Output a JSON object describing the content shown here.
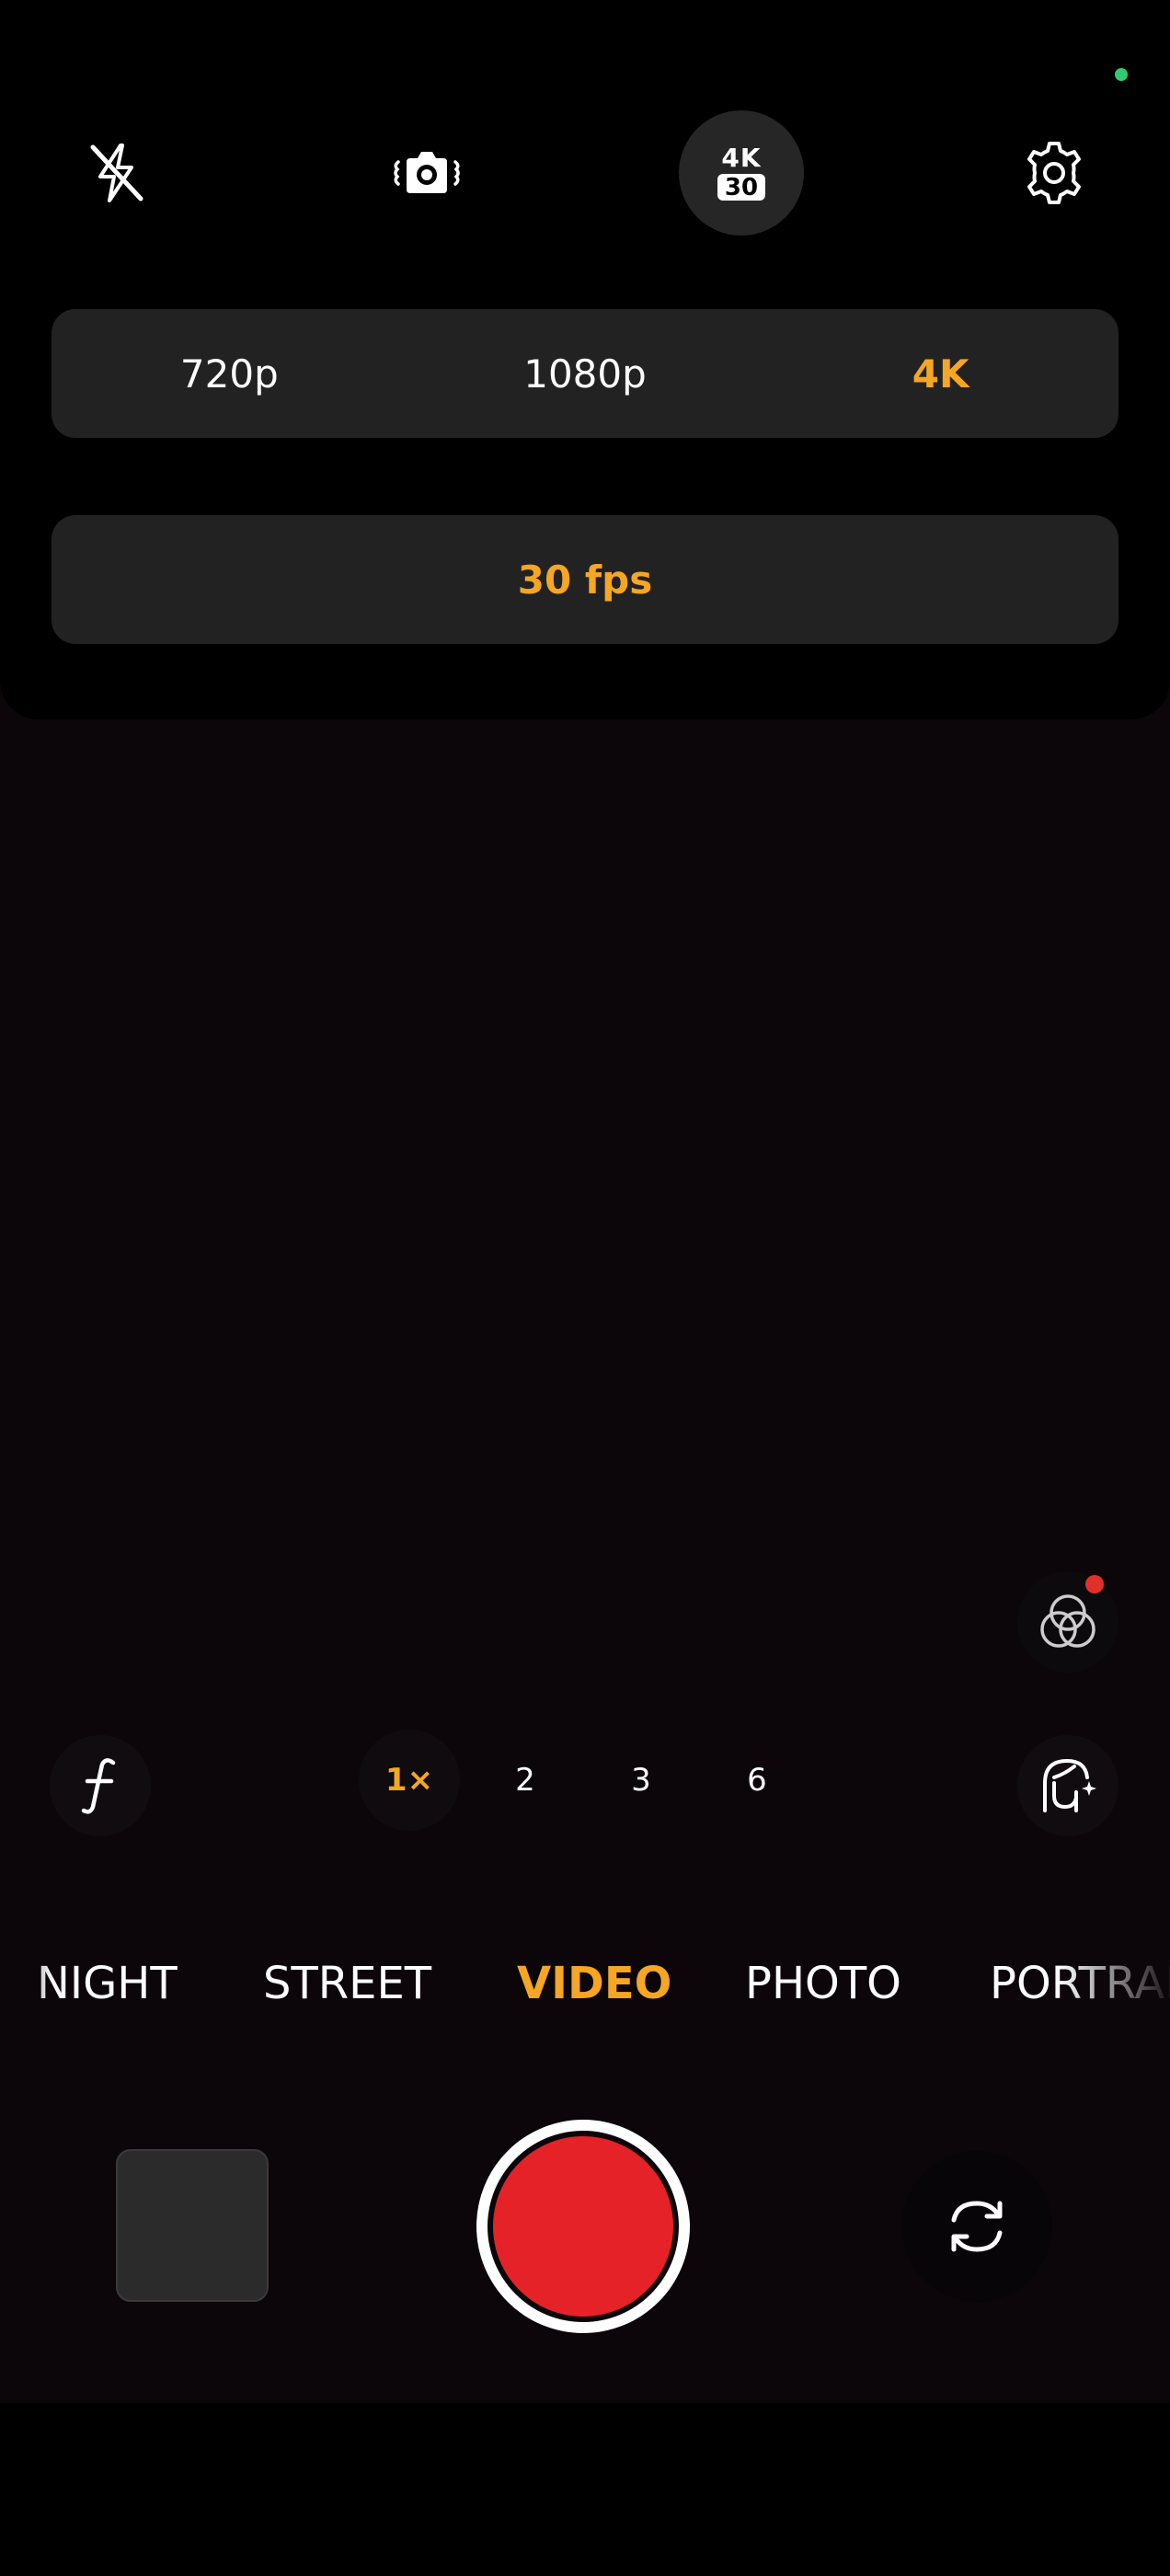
{
  "colors": {
    "accent": "#f5a623",
    "record_red": "#e52228",
    "status_dot_green": "#2ecc71",
    "notification_red": "#e0302a"
  },
  "top_bar": {
    "icons": [
      "flash-off-icon",
      "camera-stabilization-icon",
      "resolution-badge",
      "settings-gear-icon"
    ],
    "badge": {
      "resolution": "4K",
      "fps": "30"
    }
  },
  "resolution_options": {
    "items": [
      "720p",
      "1080p",
      "4K"
    ],
    "selected": "4K"
  },
  "fps_options": {
    "items": [
      "30 fps"
    ],
    "selected": "30 fps"
  },
  "side_controls": {
    "filters_icon": "filters-icon",
    "f_icon": "aperture-f-icon",
    "beauty_icon": "face-retouch-icon"
  },
  "zoom": {
    "levels": [
      "1×",
      "2",
      "3",
      "6"
    ],
    "selected": "1×"
  },
  "modes": {
    "items": [
      "NIGHT",
      "STREET",
      "VIDEO",
      "PHOTO",
      "PORTRAIT"
    ],
    "selected": "VIDEO"
  },
  "bottom": {
    "gallery_icon": "gallery-thumbnail",
    "shutter_icon": "record-button",
    "flip_icon": "switch-camera-icon"
  }
}
